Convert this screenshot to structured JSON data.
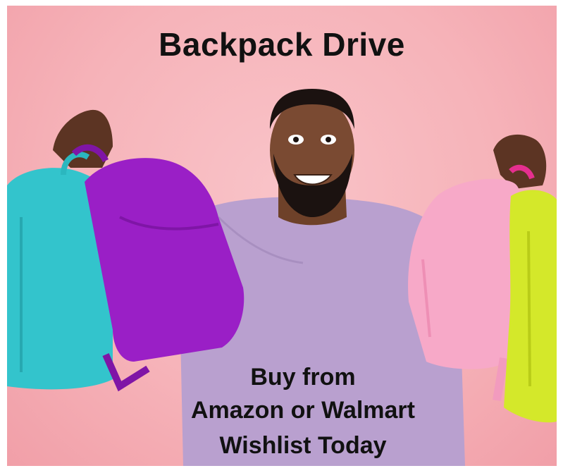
{
  "poster": {
    "title": "Backpack Drive",
    "cta_lines": [
      "Buy from",
      "Amazon or Walmart",
      "Wishlist Today"
    ]
  },
  "photo": {
    "subject": "smiling man in lavender t-shirt holding four backpacks",
    "colors": {
      "background": "#f6b3b9",
      "shirt": "#b9a0cf",
      "skin": "#7a4a32",
      "backpack_teal": "#33c4cc",
      "backpack_purple": "#9a1fc6",
      "backpack_pink": "#f7a9c8",
      "backpack_lime": "#d4e82a"
    }
  }
}
